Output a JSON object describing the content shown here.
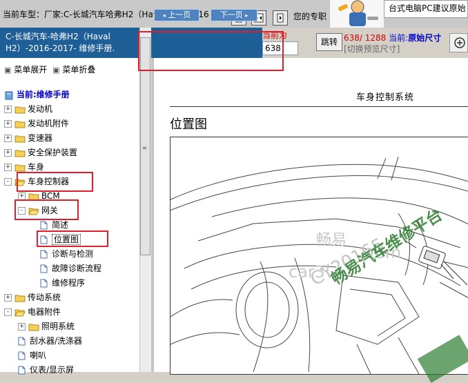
{
  "top": {
    "model_label": "当前车型：",
    "model_value": "厂家:C-长城汽车哈弗H2（Haval H2）2016",
    "hint": "您的专职",
    "ad_banner": "台式电脑PC建议原始"
  },
  "title": {
    "text": "C-长城汽车-哈弗H2（Haval H2）-2016-2017- 维修手册."
  },
  "pager": {
    "prev_label": "上一页",
    "next_label": "下一页",
    "current_label": "当前为",
    "current_page": "638",
    "jump_label": "跳转",
    "page_text": "638/ 1288",
    "current_zoom_label": "当前:",
    "current_zoom_value": "原始尺寸",
    "switch_label": "[切换预览尺寸]"
  },
  "menu": {
    "expand": "菜单展开",
    "collapse": "菜单折叠",
    "current": "当前:维修手册"
  },
  "tree": [
    {
      "label": "发动机",
      "toggle": "+",
      "type": "folder"
    },
    {
      "label": "发动机附件",
      "toggle": "+",
      "type": "folder"
    },
    {
      "label": "变速器",
      "toggle": "+",
      "type": "folder"
    },
    {
      "label": "安全保护装置",
      "toggle": "+",
      "type": "folder"
    },
    {
      "label": "车身",
      "toggle": "+",
      "type": "folder"
    },
    {
      "label": "车身控制器",
      "toggle": "-",
      "type": "folder-open"
    },
    {
      "label": "BCM",
      "toggle": "+",
      "type": "folder"
    },
    {
      "label": "网关",
      "toggle": "-",
      "type": "folder-open"
    },
    {
      "label": "简述",
      "type": "doc"
    },
    {
      "label": "位置图",
      "type": "doc",
      "selected": true
    },
    {
      "label": "诊断与检测",
      "type": "doc"
    },
    {
      "label": "故障诊断流程",
      "type": "doc"
    },
    {
      "label": "维修程序",
      "type": "doc"
    },
    {
      "label": "传动系统",
      "toggle": "+",
      "type": "folder"
    },
    {
      "label": "电器附件",
      "toggle": "-",
      "type": "folder-open"
    },
    {
      "label": "照明系统",
      "toggle": "+",
      "type": "folder"
    },
    {
      "label": "刮水器/洗涤器",
      "type": "doc"
    },
    {
      "label": "喇叭",
      "type": "doc"
    },
    {
      "label": "仪表/显示屏",
      "type": "doc"
    }
  ],
  "document": {
    "header": "车身控制系统",
    "title": "位置图"
  },
  "watermark": {
    "line1": "畅易",
    "line2": "car3",
    "line3": "com",
    "line4": "CY20165",
    "banner": "畅易汽车维修平台"
  },
  "colors": {
    "title_bar": "#1f5f97",
    "highlight": "#e11d2a",
    "watermark_green": "#2e7d32"
  }
}
